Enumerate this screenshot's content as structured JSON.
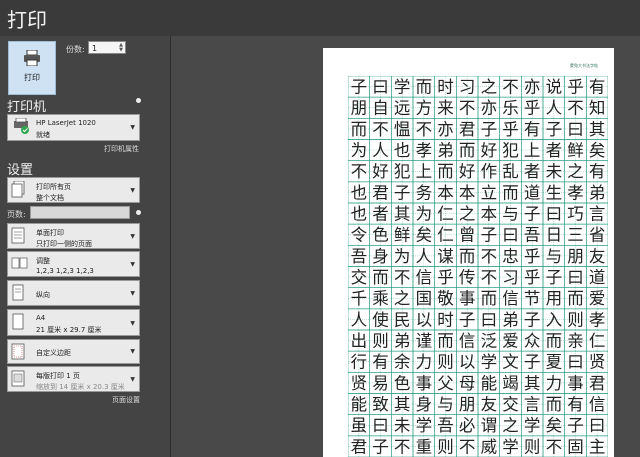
{
  "window": {
    "title": "打印"
  },
  "print_button": {
    "label": "打印",
    "icon": "printer-icon"
  },
  "copies": {
    "label": "份数:",
    "value": "1"
  },
  "printer_section": {
    "title": "打印机",
    "name": "HP LaserJet 1020",
    "status": "就绪",
    "properties_link": "打印机属性"
  },
  "settings_section": {
    "title": "设置",
    "print_range": {
      "line1": "打印所有页",
      "line2": "整个文档"
    },
    "pages_label": "页数:",
    "pages_value": "",
    "sides": {
      "line1": "单面打印",
      "line2": "只打印一侧的页面"
    },
    "collate": {
      "line1": "调整",
      "line2": "1,2,3    1,2,3    1,2,3"
    },
    "orientation": {
      "line1": "纵向"
    },
    "paper_size": {
      "line1": "A4",
      "line2": "21 厘米 x 29.7 厘米"
    },
    "margins": {
      "line1": "自定义边距"
    },
    "pages_per_sheet": {
      "line1": "每版打印 1 页",
      "line2": "缩放到 14 厘米 x 20.3 厘米"
    },
    "page_setup_link": "页面设置"
  },
  "preview": {
    "header_text": "蒙兔大书法字帖",
    "grid_color": "#2a9c83",
    "text_color": "#222222",
    "rows": [
      "子曰学而时习之不亦说乎有",
      "朋自远方来不亦乐乎人不知",
      "而不愠不亦君子乎有子曰其",
      "为人也孝弟而好犯上者鲜矣",
      "不好犯上而好作乱者未之有",
      "也君子务本本立而道生孝弟",
      "也者其为仁之本与子曰巧言",
      "令色鲜矣仁曾子曰吾日三省",
      "吾身为人谋而不忠乎与朋友",
      "交而不信乎传不习乎子曰道",
      "千乘之国敬事而信节用而爱",
      "人使民以时子曰弟子入则孝",
      "出则弟谨而信泛爱众而亲仁",
      "行有余力则以学文子夏曰贤",
      "贤易色事父母能竭其力事君",
      "能致其身与朋友交言而有信",
      "虽曰未学吾必谓之学矣子曰",
      "君子不重则不威学则不固主"
    ]
  }
}
